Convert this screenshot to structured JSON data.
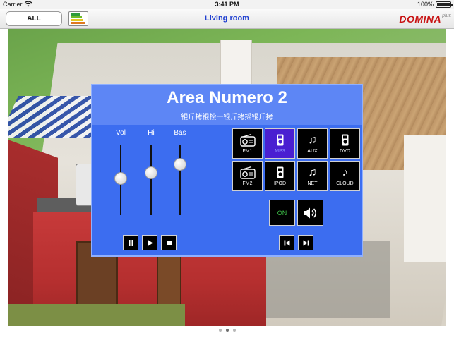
{
  "status_bar": {
    "carrier": "Carrier",
    "time": "3:41 PM",
    "battery": "100%",
    "battery_level": 1.0
  },
  "header": {
    "all_button_label": "ALL",
    "page_title": "Living room",
    "logo_text": "DOMINA",
    "logo_suffix": "plus",
    "energy_icon": "energy-rating-icon"
  },
  "panel": {
    "title": "Area Numero 2",
    "subtitle": "锟斤拷锟桧一锟斤拷摇锟斤拷",
    "sliders": [
      {
        "label": "Vol",
        "level": 0.52
      },
      {
        "label": "Hi",
        "level": 0.6
      },
      {
        "label": "Bas",
        "level": 0.72
      }
    ],
    "sources": [
      {
        "label": "FM1",
        "icon": "radio-icon",
        "active": false
      },
      {
        "label": "MP3",
        "icon": "music-player-icon",
        "active": true
      },
      {
        "label": "AUX",
        "icon": "music-note-icon",
        "active": false
      },
      {
        "label": "DVD",
        "icon": "music-player-icon",
        "active": false
      },
      {
        "label": "FM2",
        "icon": "radio-icon",
        "active": false
      },
      {
        "label": "IPOD",
        "icon": "music-player-icon",
        "active": false
      },
      {
        "label": "NET",
        "icon": "music-note-icon",
        "active": false
      },
      {
        "label": "CLOUD",
        "icon": "music-note-icon",
        "active": false
      }
    ],
    "power_label": "ON",
    "power_color": "#3ec64a",
    "accent_color": "#3c6df0",
    "active_source_color": "#4a1fd1"
  },
  "page_indicator": {
    "count": 3,
    "current": 2
  }
}
